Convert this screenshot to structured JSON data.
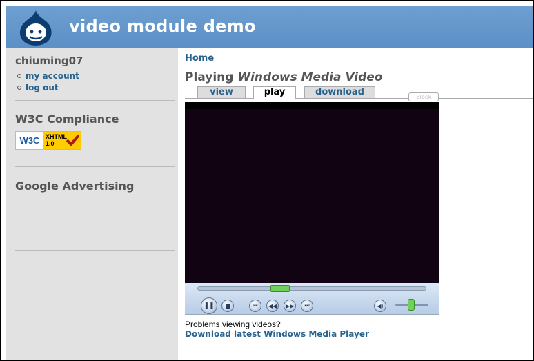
{
  "header": {
    "site_name": "video module demo",
    "logo_icon": "drupal-drop-icon"
  },
  "sidebar": {
    "user_block_title": "chiuming07",
    "user_menu": [
      {
        "label": "my account"
      },
      {
        "label": "log out"
      }
    ],
    "w3c_block_title": "W3C Compliance",
    "w3c_badge": {
      "w3c_text": "W3C",
      "xhtml_text": "XHTML",
      "version_text": "1.0",
      "icon": "checkmark-icon"
    },
    "ads_block_title": "Google Advertising"
  },
  "main": {
    "breadcrumb": "Home",
    "title_prefix": "Playing ",
    "title_emphasis": "Windows Media Video",
    "tabs": [
      {
        "label": "view",
        "active": false
      },
      {
        "label": "play",
        "active": true
      },
      {
        "label": "download",
        "active": false
      }
    ],
    "block_tag": "Block",
    "player": {
      "controls": [
        "pause-icon",
        "stop-icon",
        "previous-icon",
        "rewind-icon",
        "fast-forward-icon",
        "next-icon",
        "mute-icon"
      ],
      "seek_position": 0.37,
      "volume_level": 0.55
    },
    "problems_text": "Problems viewing videos?",
    "download_link": "Download latest Windows Media Player"
  },
  "colors": {
    "header_blue": "#6e9fd0",
    "link_blue": "#27638c",
    "sidebar_gray": "#e2e2e2",
    "player_green": "#6fd05a"
  }
}
